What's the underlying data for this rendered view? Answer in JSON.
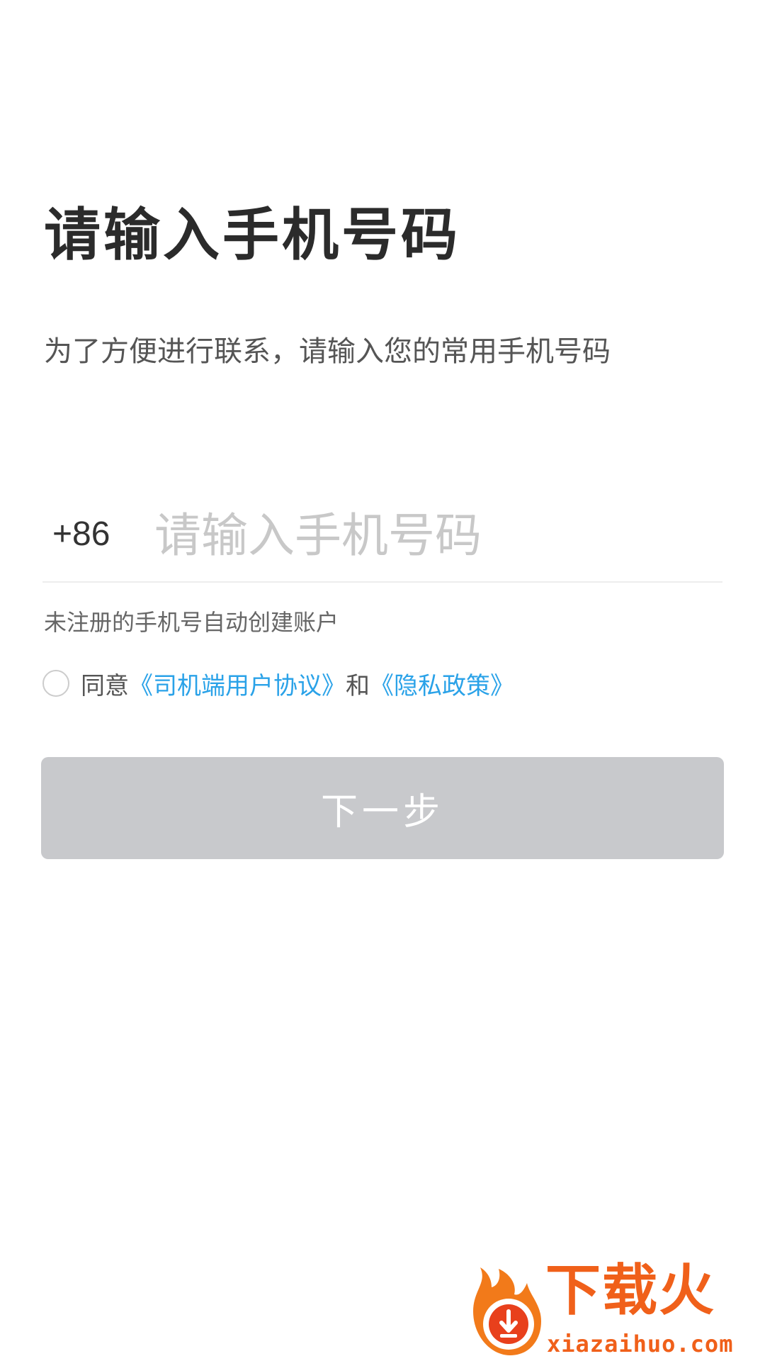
{
  "page": {
    "title": "请输入手机号码",
    "subtitle": "为了方便进行联系，请输入您的常用手机号码"
  },
  "phone": {
    "country_code": "+86",
    "placeholder": "请输入手机号码",
    "value": ""
  },
  "hint": "未注册的手机号自动创建账户",
  "agreement": {
    "checked": false,
    "prefix": "同意",
    "driver_agreement_link": "《司机端用户协议》",
    "conjunction": "和",
    "privacy_policy_link": "《隐私政策》"
  },
  "next_button": {
    "label": "下一步",
    "enabled": false
  },
  "watermark": {
    "brand": "下载火",
    "domain": "xiazaihuo.com"
  },
  "colors": {
    "link": "#2aa2e8",
    "button_disabled": "#c8c9cc",
    "watermark": "#f0601a"
  }
}
